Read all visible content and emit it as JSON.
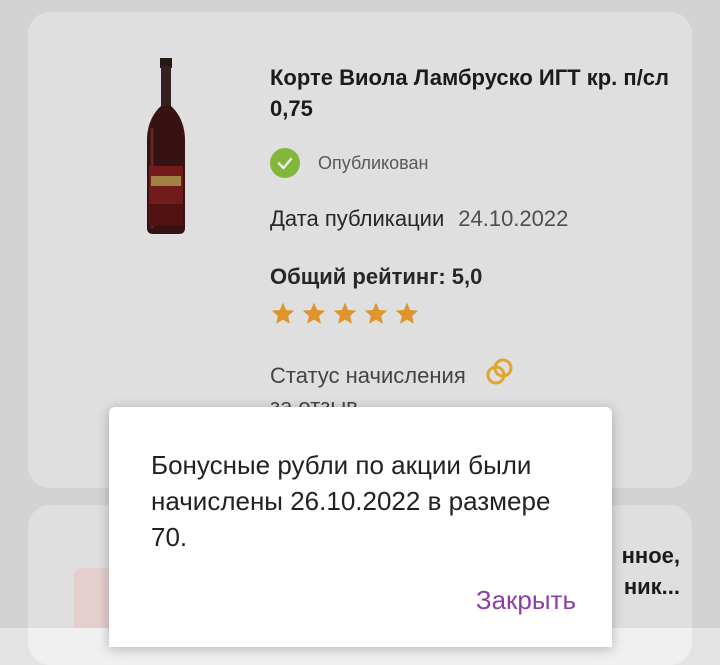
{
  "product": {
    "title": "Корте Виола Ламбруско ИГТ кр. п/сл 0,75",
    "status": "Опубликован",
    "date_label": "Дата публикации",
    "date_value": "24.10.2022",
    "rating_label": "Общий рейтинг: 5,0",
    "rating": 5,
    "rating_max": 5,
    "accrual_line1": "Статус начисления",
    "accrual_line2": "за отзыв"
  },
  "next_card": {
    "line1": "нное,",
    "line2": "ник..."
  },
  "dialog": {
    "message": "Бонусные рубли по акции были начислены 26.10.2022 в размере 70.",
    "close_label": "Закрыть"
  },
  "colors": {
    "accent": "#8c3ea8",
    "status_green": "#8bc53f",
    "star": "#f0a030",
    "coin": "#f2b233"
  }
}
